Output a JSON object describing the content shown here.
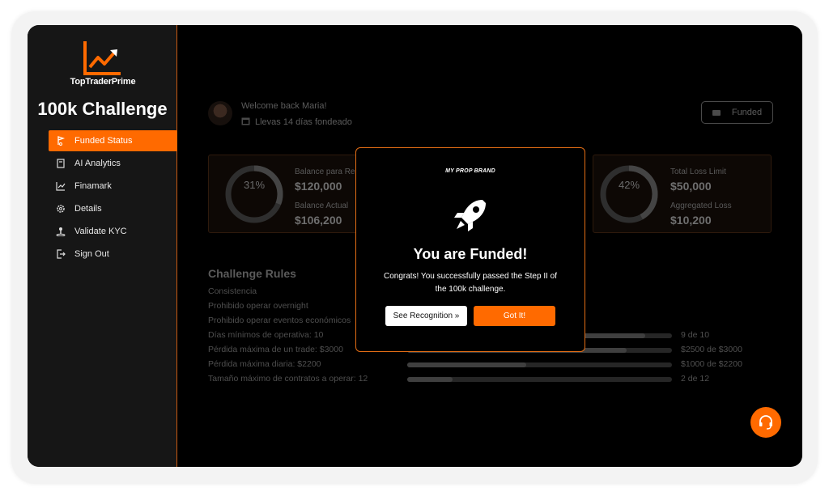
{
  "brand": {
    "logo_text": "TopTraderPrime",
    "accent": "#ff6a00"
  },
  "sidebar": {
    "challenge_title": "100k Challenge",
    "items": [
      {
        "label": "Funded Status",
        "icon": "flag-icon",
        "active": true
      },
      {
        "label": "AI Analytics",
        "icon": "book-icon",
        "active": false
      },
      {
        "label": "Finamark",
        "icon": "chart-line-icon",
        "active": false
      },
      {
        "label": "Details",
        "icon": "gear-icon",
        "active": false
      },
      {
        "label": "Validate KYC",
        "icon": "person-icon",
        "active": false
      },
      {
        "label": "Sign Out",
        "icon": "sign-out-icon",
        "active": false
      }
    ]
  },
  "header": {
    "welcome": "Welcome back Maria!",
    "days": "Llevas 14 días fondeado",
    "funded_button": "Funded"
  },
  "cards": {
    "left": {
      "ring_value": "31%",
      "ring_fraction": 0.31,
      "label1": "Balance para Re",
      "value1": "$120,000",
      "label2": "Balance Actual",
      "value2": "$106,200"
    },
    "right": {
      "ring_value": "42%",
      "ring_fraction": 0.42,
      "label1": "Total Loss Limit",
      "value1": "$50,000",
      "label2": "Aggregated Loss",
      "value2": "$10,200"
    }
  },
  "rules": {
    "title": "Challenge Rules",
    "items": [
      {
        "label": "Consistencia",
        "progress": null,
        "value": ""
      },
      {
        "label": "Prohibido operar overnight",
        "progress": null,
        "value": ""
      },
      {
        "label": "Prohibido operar eventos económicos",
        "progress": null,
        "value": ""
      },
      {
        "label": "Días mínimos de operativa: 10",
        "progress": 0.9,
        "value": "9 de 10"
      },
      {
        "label": "Pérdida máxima de un trade: $3000",
        "progress": 0.83,
        "value": "$2500 de $3000"
      },
      {
        "label": "Pérdida máxima diaria: $2200",
        "progress": 0.45,
        "value": "$1000 de $2200"
      },
      {
        "label": "Tamaño máximo de contratos a operar: 12",
        "progress": 0.17,
        "value": "2 de 12"
      }
    ]
  },
  "modal": {
    "brand": "MY PROP BRAND",
    "title": "You are Funded!",
    "message": "Congrats! You successfully passed the Step II of the 100k challenge.",
    "recognition_button": "See Recognition »",
    "got_it_button": "Got It!"
  },
  "support": {
    "icon": "headset-icon"
  }
}
